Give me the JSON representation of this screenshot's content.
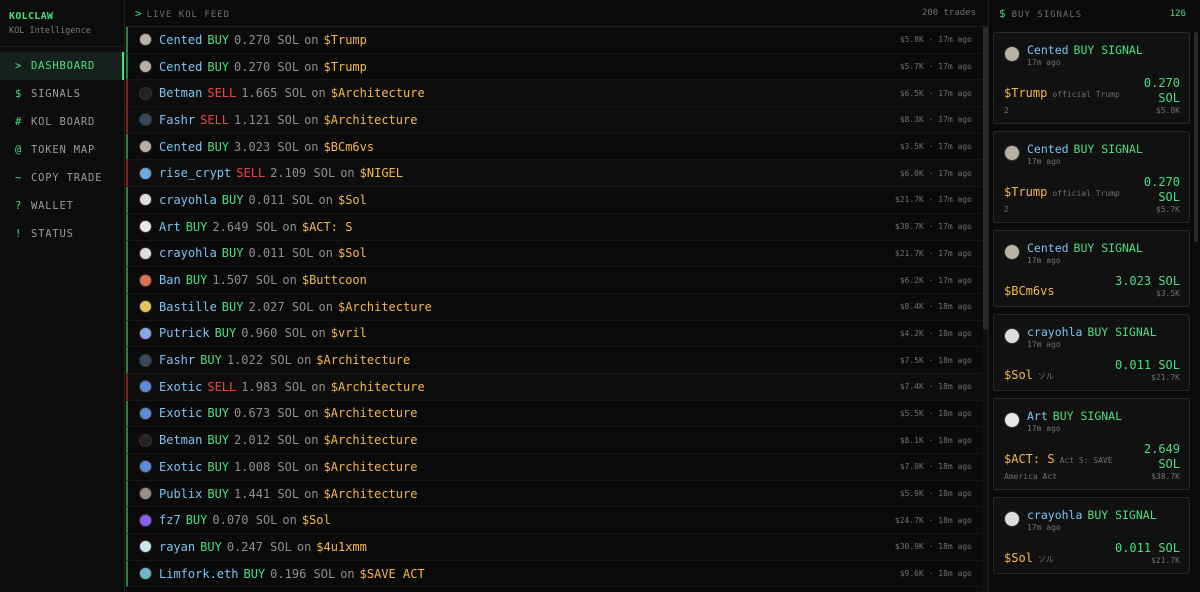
{
  "brand": {
    "name": "KOLCLAW",
    "subtitle": "KOL Intelligence"
  },
  "nav": [
    {
      "glyph": ">",
      "label": "DASHBOARD",
      "active": true
    },
    {
      "glyph": "$",
      "label": "SIGNALS"
    },
    {
      "glyph": "#",
      "label": "KOL BOARD"
    },
    {
      "glyph": "@",
      "label": "TOKEN MAP"
    },
    {
      "glyph": "~",
      "label": "COPY TRADE"
    },
    {
      "glyph": "?",
      "label": "WALLET"
    },
    {
      "glyph": "!",
      "label": "STATUS"
    }
  ],
  "feed": {
    "title": "LIVE KOL FEED",
    "count": "200 trades",
    "on_word": "on",
    "rows": [
      {
        "kol": "Cented",
        "action": "BUY",
        "amount": "0.270 SOL",
        "token": "$Trump",
        "mc": "$5.8K",
        "time": "17m ago",
        "avatar": "#b9b2a4"
      },
      {
        "kol": "Cented",
        "action": "BUY",
        "amount": "0.270 SOL",
        "token": "$Trump",
        "mc": "$5.7K",
        "time": "17m ago",
        "avatar": "#b9b2a4"
      },
      {
        "kol": "Betman",
        "action": "SELL",
        "amount": "1.665 SOL",
        "token": "$Architecture",
        "mc": "$6.5K",
        "time": "17m ago",
        "avatar": "#222222"
      },
      {
        "kol": "Fashr",
        "action": "SELL",
        "amount": "1.121 SOL",
        "token": "$Architecture",
        "mc": "$8.3K",
        "time": "17m ago",
        "avatar": "#34495e"
      },
      {
        "kol": "Cented",
        "action": "BUY",
        "amount": "3.023 SOL",
        "token": "$BCm6vs",
        "mc": "$3.5K",
        "time": "17m ago",
        "avatar": "#b9b2a4"
      },
      {
        "kol": "rise_crypt",
        "action": "SELL",
        "amount": "2.109 SOL",
        "token": "$NIGEL",
        "mc": "$6.0K",
        "time": "17m ago",
        "avatar": "#6fa8dc"
      },
      {
        "kol": "crayohla",
        "action": "BUY",
        "amount": "0.011 SOL",
        "token": "$Sol",
        "mc": "$21.7K",
        "time": "17m ago",
        "avatar": "#dddddd"
      },
      {
        "kol": "Art",
        "action": "BUY",
        "amount": "2.649 SOL",
        "token": "$ACT: S",
        "mc": "$38.7K",
        "time": "17m ago",
        "avatar": "#e8e8e8"
      },
      {
        "kol": "crayohla",
        "action": "BUY",
        "amount": "0.011 SOL",
        "token": "$Sol",
        "mc": "$21.7K",
        "time": "17m ago",
        "avatar": "#dddddd"
      },
      {
        "kol": "Ban",
        "action": "BUY",
        "amount": "1.507 SOL",
        "token": "$Buttcoon",
        "mc": "$6.2K",
        "time": "17m ago",
        "avatar": "#d9734a"
      },
      {
        "kol": "Bastille",
        "action": "BUY",
        "amount": "2.027 SOL",
        "token": "$Architecture",
        "mc": "$8.4K",
        "time": "18m ago",
        "avatar": "#e6c35c"
      },
      {
        "kol": "Putrick",
        "action": "BUY",
        "amount": "0.960 SOL",
        "token": "$vril",
        "mc": "$4.2K",
        "time": "18m ago",
        "avatar": "#8aa8e0"
      },
      {
        "kol": "Fashr",
        "action": "BUY",
        "amount": "1.022 SOL",
        "token": "$Architecture",
        "mc": "$7.5K",
        "time": "18m ago",
        "avatar": "#34495e"
      },
      {
        "kol": "Exotic",
        "action": "SELL",
        "amount": "1.983 SOL",
        "token": "$Architecture",
        "mc": "$7.4K",
        "time": "18m ago",
        "avatar": "#5b8bd6"
      },
      {
        "kol": "Exotic",
        "action": "BUY",
        "amount": "0.673 SOL",
        "token": "$Architecture",
        "mc": "$5.5K",
        "time": "18m ago",
        "avatar": "#5b8bd6"
      },
      {
        "kol": "Betman",
        "action": "BUY",
        "amount": "2.012 SOL",
        "token": "$Architecture",
        "mc": "$8.1K",
        "time": "18m ago",
        "avatar": "#222222"
      },
      {
        "kol": "Exotic",
        "action": "BUY",
        "amount": "1.008 SOL",
        "token": "$Architecture",
        "mc": "$7.0K",
        "time": "18m ago",
        "avatar": "#5b8bd6"
      },
      {
        "kol": "Publix",
        "action": "BUY",
        "amount": "1.441 SOL",
        "token": "$Architecture",
        "mc": "$5.9K",
        "time": "18m ago",
        "avatar": "#9a8f86"
      },
      {
        "kol": "fz7",
        "action": "BUY",
        "amount": "0.070 SOL",
        "token": "$Sol",
        "mc": "$24.7K",
        "time": "18m ago",
        "avatar": "#8b5cf6"
      },
      {
        "kol": "rayan",
        "action": "BUY",
        "amount": "0.247 SOL",
        "token": "$4u1xmm",
        "mc": "$30.9K",
        "time": "18m ago",
        "avatar": "#d0e4f0"
      },
      {
        "kol": "Limfork.eth",
        "action": "BUY",
        "amount": "0.196 SOL",
        "token": "$SAVE ACT",
        "mc": "$9.6K",
        "time": "18m ago",
        "avatar": "#6fb8c9"
      }
    ]
  },
  "signals": {
    "title": "BUY SIGNALS",
    "count": "126",
    "tag": "BUY SIGNAL",
    "cards": [
      {
        "kol": "Cented",
        "time": "17m ago",
        "token": "$Trump",
        "desc": "official Trump",
        "desc2": "2",
        "sol": "0.270",
        "sol_unit": "SOL",
        "mc": "$5.8K",
        "avatar": "#b9b2a4"
      },
      {
        "kol": "Cented",
        "time": "17m ago",
        "token": "$Trump",
        "desc": "official Trump",
        "desc2": "2",
        "sol": "0.270",
        "sol_unit": "SOL",
        "mc": "$5.7K",
        "avatar": "#b9b2a4"
      },
      {
        "kol": "Cented",
        "time": "17m ago",
        "token": "$BCm6vs",
        "desc": "",
        "desc2": "",
        "sol": "3.023 SOL",
        "sol_unit": "",
        "mc": "$3.5K",
        "avatar": "#b9b2a4"
      },
      {
        "kol": "crayohla",
        "time": "17m ago",
        "token": "$Sol",
        "desc": "ソル",
        "desc2": "",
        "sol": "0.011 SOL",
        "sol_unit": "",
        "mc": "$21.7K",
        "avatar": "#dddddd"
      },
      {
        "kol": "Art",
        "time": "17m ago",
        "token": "$ACT: S",
        "desc": "Act S: SAVE",
        "desc2": "America Act",
        "sol": "2.649",
        "sol_unit": "SOL",
        "mc": "$38.7K",
        "avatar": "#e8e8e8"
      },
      {
        "kol": "crayohla",
        "time": "17m ago",
        "token": "$Sol",
        "desc": "ソル",
        "desc2": "",
        "sol": "0.011 SOL",
        "sol_unit": "",
        "mc": "$21.7K",
        "avatar": "#dddddd"
      }
    ]
  },
  "colors": {
    "accent": "#4ade80",
    "sell": "#ef4444",
    "kol": "#7cc4f0",
    "token": "#f5b74a"
  }
}
